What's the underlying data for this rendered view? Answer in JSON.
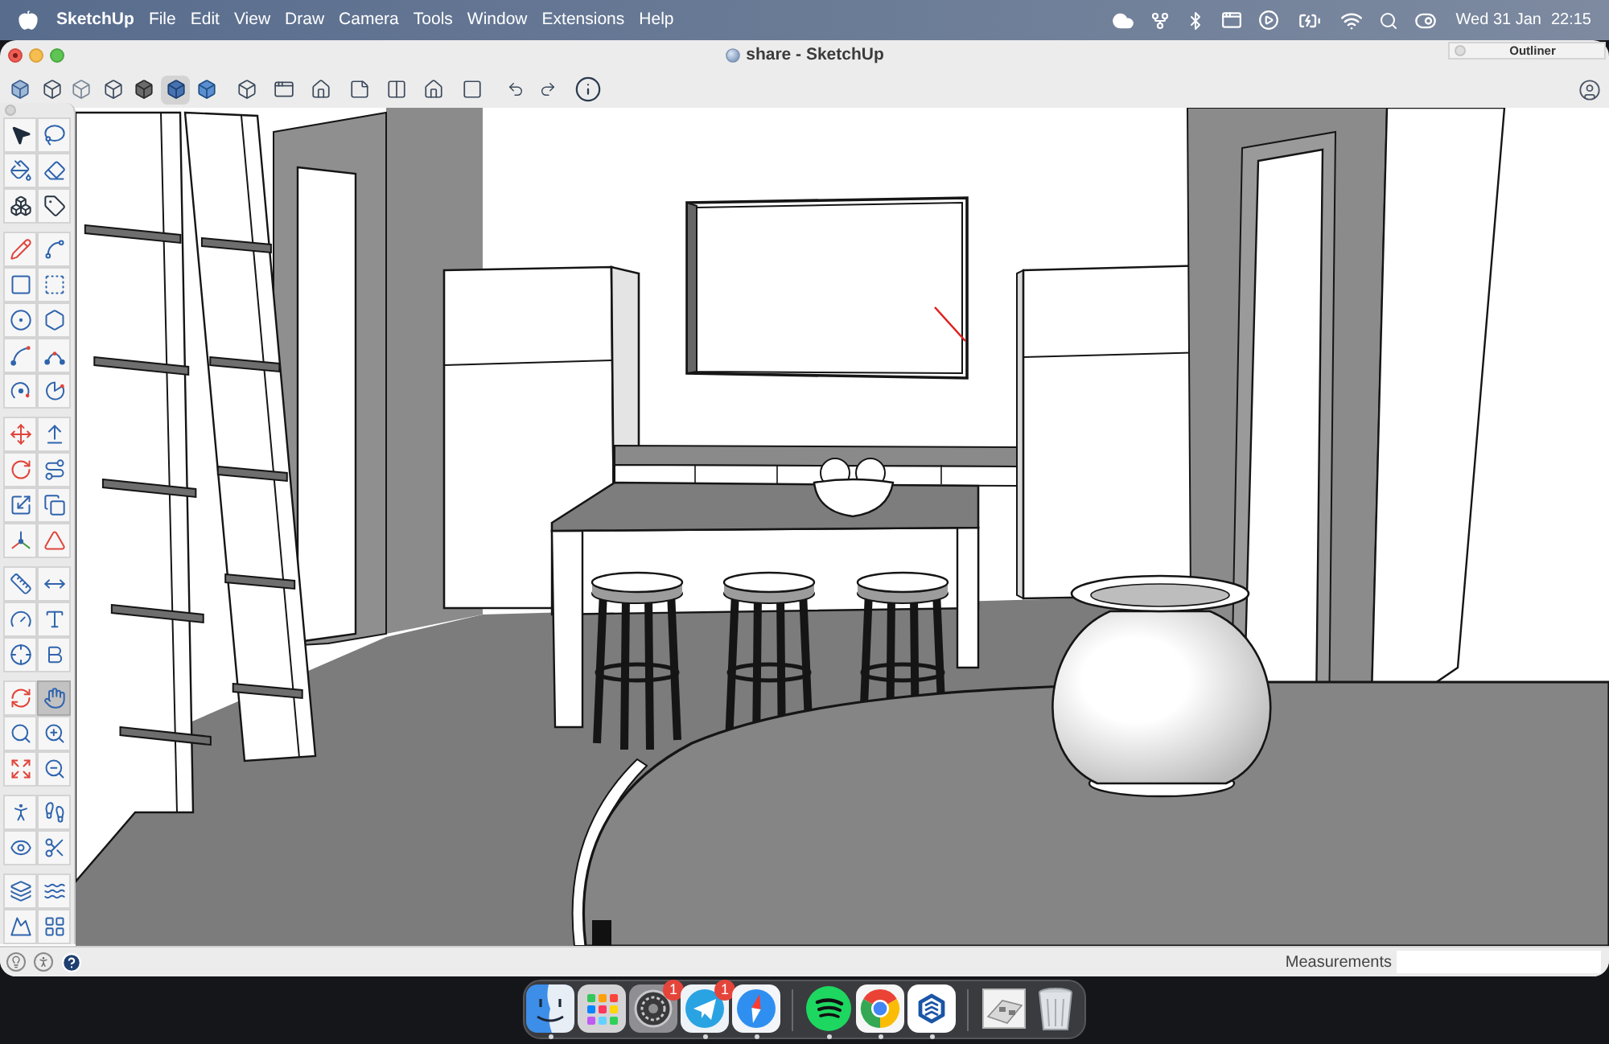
{
  "menu_bar": {
    "app_name": "SketchUp",
    "menus": [
      "File",
      "Edit",
      "View",
      "Draw",
      "Camera",
      "Tools",
      "Window",
      "Extensions",
      "Help"
    ],
    "date": "Wed 31 Jan",
    "time": "22:15"
  },
  "window": {
    "title": "share - SketchUp"
  },
  "outliner": {
    "title": "Outliner"
  },
  "toolbar": [
    {
      "selected": false
    },
    {
      "selected": false
    },
    {
      "selected": false
    },
    {
      "selected": false
    },
    {
      "selected": false
    },
    {
      "selected": true
    },
    {
      "selected": false
    },
    {
      "selected": false
    },
    {
      "selected": false
    },
    {
      "selected": false
    },
    {
      "selected": false
    },
    {
      "selected": false
    },
    {
      "selected": false
    },
    {
      "selected": false
    },
    {
      "selected": false
    },
    {
      "selected": false
    },
    {
      "selected": false
    }
  ],
  "tool_palette": {
    "groups": [
      {
        "tools": [
          {
            "selected": false
          },
          {
            "selected": false
          },
          {
            "selected": false
          },
          {
            "selected": false
          },
          {
            "selected": false
          },
          {
            "selected": false
          }
        ]
      },
      {
        "tools": [
          {
            "selected": false
          },
          {
            "selected": false
          },
          {
            "selected": false
          },
          {
            "selected": false
          },
          {
            "selected": false
          },
          {
            "selected": false
          },
          {
            "selected": false
          },
          {
            "selected": false
          },
          {
            "selected": false
          },
          {
            "selected": false
          }
        ]
      },
      {
        "tools": [
          {
            "selected": false
          },
          {
            "selected": false
          },
          {
            "selected": false
          },
          {
            "selected": false
          },
          {
            "selected": false
          },
          {
            "selected": false
          },
          {
            "selected": false
          },
          {
            "selected": false
          }
        ]
      },
      {
        "tools": [
          {
            "selected": false
          },
          {
            "selected": false
          },
          {
            "selected": false
          },
          {
            "selected": false
          },
          {
            "selected": false
          },
          {
            "selected": false
          }
        ]
      },
      {
        "tools": [
          {
            "selected": false
          },
          {
            "selected": true
          },
          {
            "selected": false
          },
          {
            "selected": false
          },
          {
            "selected": false
          },
          {
            "selected": false
          }
        ]
      },
      {
        "tools": [
          {
            "selected": false
          },
          {
            "selected": false
          },
          {
            "selected": false
          },
          {
            "selected": false
          }
        ]
      },
      {
        "tools": [
          {
            "selected": false
          },
          {
            "selected": false
          },
          {
            "selected": false
          },
          {
            "selected": false
          }
        ]
      }
    ]
  },
  "status_bar": {
    "measurements_label": "Measurements"
  },
  "dock": {
    "sections": [
      {
        "items": [
          {
            "running": true
          },
          {
            "running": false
          },
          {
            "running": false,
            "badge": "1"
          },
          {
            "running": true,
            "badge": "1"
          },
          {
            "running": true
          }
        ]
      },
      {
        "items": [
          {
            "running": true
          },
          {
            "running": true
          },
          {
            "running": true
          }
        ]
      },
      {
        "items": [
          {
            "running": false
          },
          {
            "running": false
          }
        ]
      }
    ]
  }
}
